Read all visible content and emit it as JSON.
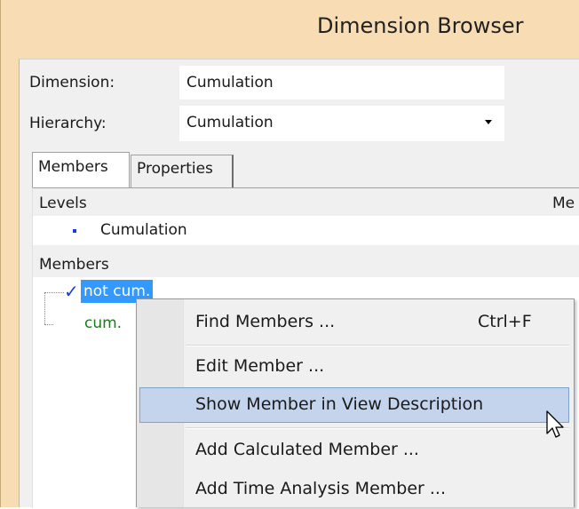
{
  "window": {
    "title": "Dimension Browser"
  },
  "form": {
    "dimension_label": "Dimension:",
    "dimension_value": "Cumulation",
    "hierarchy_label": "Hierarchy:",
    "hierarchy_value": "Cumulation"
  },
  "tabs": [
    {
      "label": "Members",
      "active": true
    },
    {
      "label": "Properties",
      "active": false
    }
  ],
  "levels": {
    "header": "Levels",
    "header_right": "Me",
    "items": [
      "Cumulation"
    ]
  },
  "members": {
    "header": "Members",
    "items": [
      {
        "label": "not cum.",
        "selected": true,
        "checked": true
      },
      {
        "label": "cum.",
        "selected": false,
        "checked": false
      }
    ]
  },
  "context_menu": {
    "items": [
      {
        "label": "Find Members ...",
        "shortcut": "Ctrl+F"
      },
      {
        "label": "Edit Member ...",
        "shortcut": ""
      },
      {
        "label": "Show Member in View Description",
        "shortcut": "",
        "hovered": true
      },
      {
        "label": "Add Calculated Member ...",
        "shortcut": ""
      },
      {
        "label": "Add Time Analysis Member ...",
        "shortcut": ""
      }
    ]
  },
  "colors": {
    "title_bar": "#f7dcb4",
    "selection": "#3399ff",
    "menu_hover": "#c4d4ec",
    "member_text": "#1b7a1b",
    "bullet": "#1a3fd6"
  }
}
